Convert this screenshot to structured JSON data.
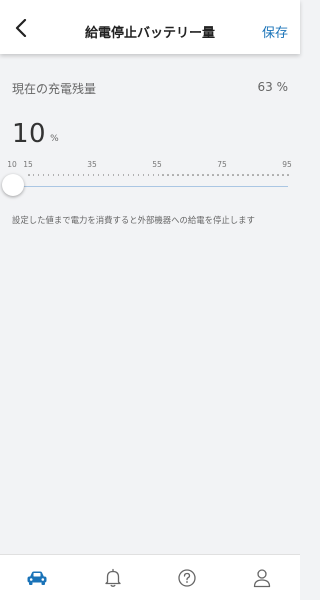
{
  "header": {
    "title": "給電停止バッテリー量",
    "save_label": "保存",
    "back_icon": "chevron-left-icon"
  },
  "current_charge": {
    "label": "現在の充電残量",
    "value": "63 %"
  },
  "setting": {
    "value": "10",
    "unit": "%",
    "min": 10,
    "max": 95,
    "tick_labels": [
      "10",
      "15",
      "35",
      "55",
      "75",
      "95"
    ],
    "description": "設定した値まで電力を消費すると外部機器への給電を停止します"
  },
  "bottom_nav": {
    "items": [
      {
        "icon": "car-icon",
        "active": true
      },
      {
        "icon": "bell-icon",
        "active": false
      },
      {
        "icon": "help-circle-icon",
        "active": false
      },
      {
        "icon": "user-icon",
        "active": false
      }
    ]
  },
  "colors": {
    "accent": "#1a73b8",
    "track": "#aac6e3",
    "background": "#f2f3f5"
  }
}
